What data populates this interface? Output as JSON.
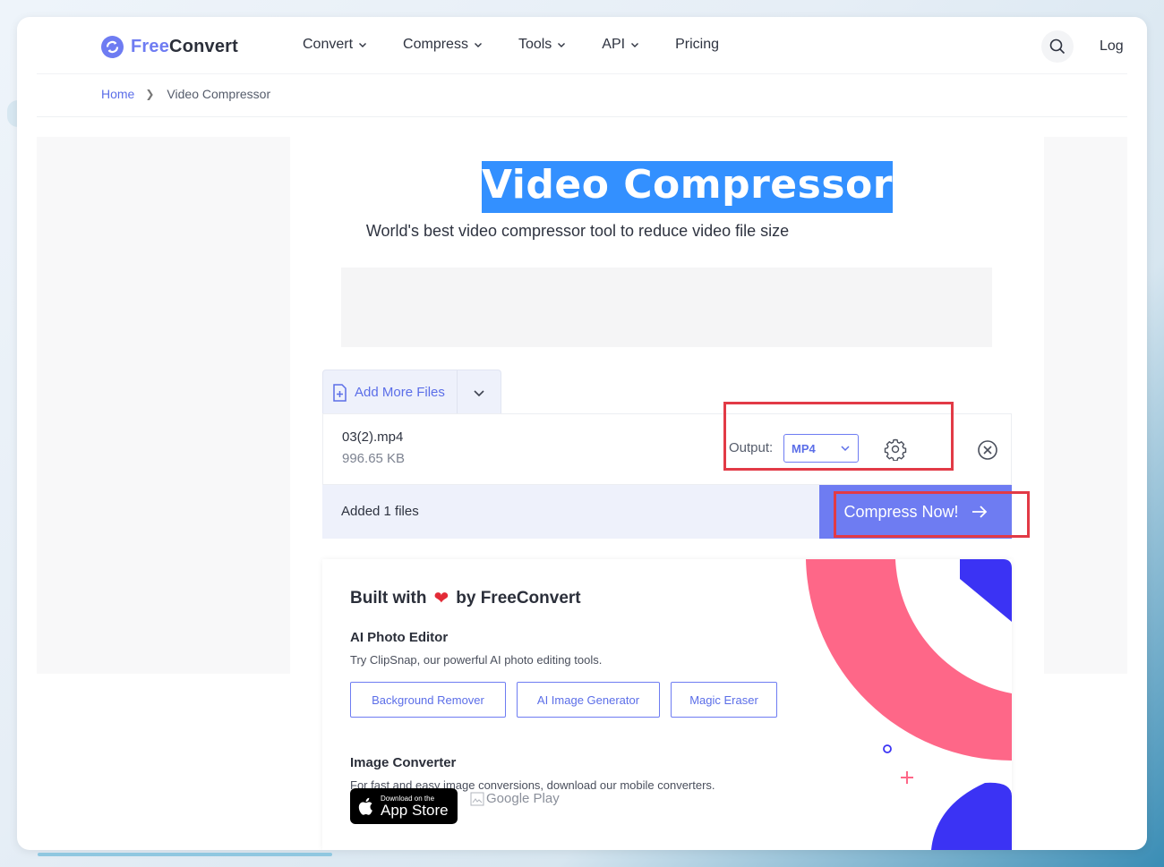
{
  "header": {
    "logo_free": "Free",
    "logo_convert": "Convert",
    "nav": [
      {
        "label": "Convert",
        "has_dropdown": true
      },
      {
        "label": "Compress",
        "has_dropdown": true
      },
      {
        "label": "Tools",
        "has_dropdown": true
      },
      {
        "label": "API",
        "has_dropdown": true
      },
      {
        "label": "Pricing",
        "has_dropdown": false
      }
    ],
    "search_icon": "search-icon",
    "login_label": "Log"
  },
  "breadcrumb": {
    "home": "Home",
    "current": "Video Compressor"
  },
  "hero": {
    "title": "Video Compressor",
    "subtitle": "World's best video compressor tool to reduce video file size"
  },
  "upload": {
    "add_more_label": "Add More Files",
    "file": {
      "name": "03(2).mp4",
      "size": "996.65 KB"
    },
    "output_label": "Output:",
    "output_format": "MP4",
    "added_text": "Added 1 files",
    "compress_label": "Compress Now!"
  },
  "built_with": {
    "prefix": "Built with",
    "suffix": "by FreeConvert",
    "photo_editor": {
      "heading": "AI Photo Editor",
      "text": "Try ClipSnap, our powerful AI photo editing tools.",
      "buttons": [
        "Background Remover",
        "AI Image Generator",
        "Magic Eraser"
      ]
    },
    "image_converter": {
      "heading": "Image Converter",
      "text": "For fast and easy image conversions, download our mobile converters.",
      "appstore_small": "Download on the",
      "appstore_big": "App Store",
      "google_play": "Google Play"
    }
  },
  "colors": {
    "accent": "#6e7cf2",
    "title_highlight": "#3390ff",
    "annotation_red": "#e23a46",
    "deco_pink": "#fe6788",
    "deco_blue": "#3b33f4"
  }
}
